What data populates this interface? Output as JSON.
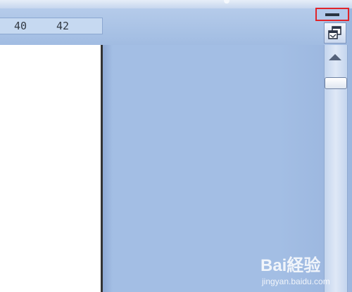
{
  "ruler": {
    "numbers": [
      "40",
      "42"
    ]
  },
  "window_controls": {
    "minimize_icon": "minimize-icon",
    "restore_icon": "restore-window-icon",
    "highlight_color": "#e0242a"
  },
  "scrollbar": {
    "up_icon": "scroll-up-arrow-icon"
  },
  "watermark": {
    "brand": "Bai経验",
    "url": "jingyan.baidu.com"
  },
  "colors": {
    "workspace": "#a3bee4",
    "page": "#ffffff",
    "ruler": "#c6d9f1"
  }
}
